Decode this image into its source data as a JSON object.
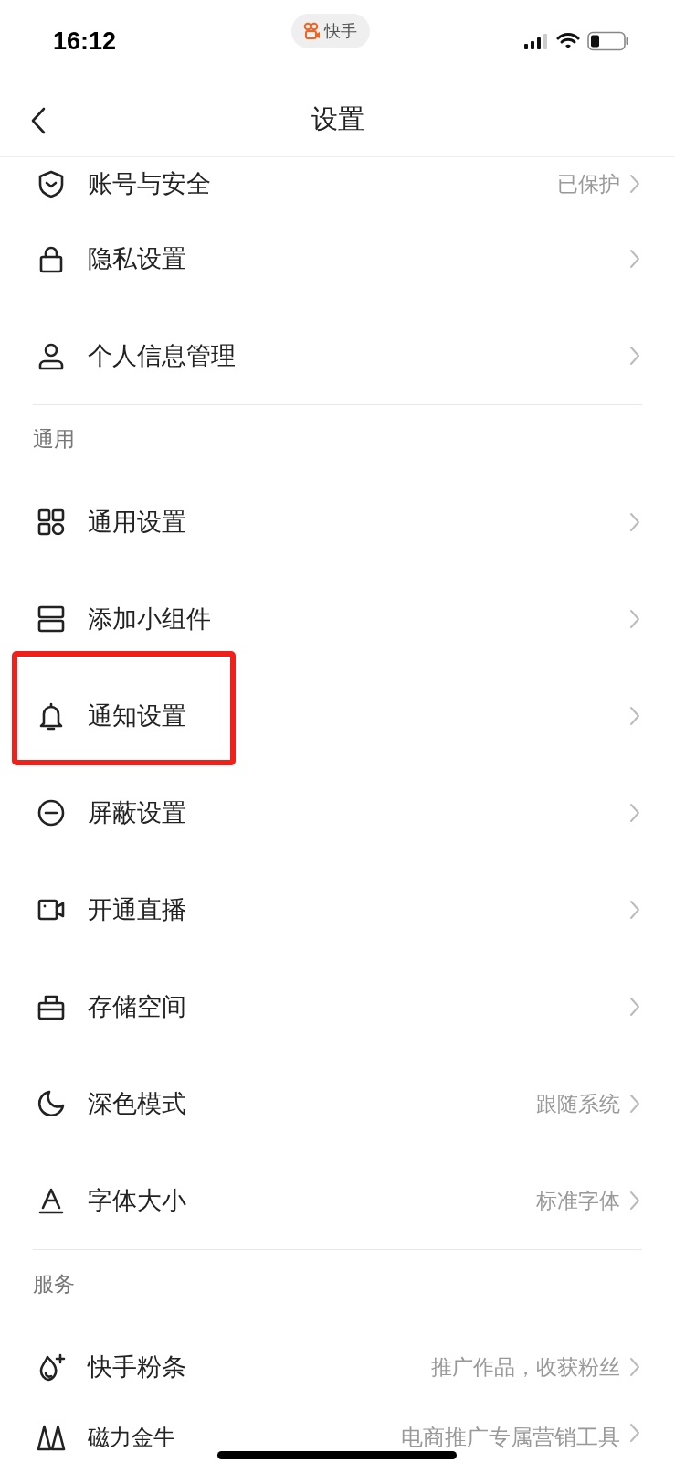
{
  "status_bar": {
    "time": "16:12",
    "app_pill": "快手"
  },
  "nav": {
    "title": "设置"
  },
  "sections": [
    {
      "items": [
        {
          "label": "账号与安全",
          "value": "已保护",
          "highlighted": false
        },
        {
          "label": "隐私设置",
          "highlighted": false
        },
        {
          "label": "个人信息管理",
          "highlighted": false
        }
      ]
    },
    {
      "header": "通用",
      "items": [
        {
          "label": "通用设置",
          "highlighted": false
        },
        {
          "label": "添加小组件",
          "highlighted": false
        },
        {
          "label": "通知设置",
          "highlighted": true
        },
        {
          "label": "屏蔽设置",
          "highlighted": false
        },
        {
          "label": "开通直播",
          "highlighted": false
        },
        {
          "label": "存储空间",
          "highlighted": false
        },
        {
          "label": "深色模式",
          "value": "跟随系统",
          "highlighted": false
        },
        {
          "label": "字体大小",
          "value": "标准字体",
          "highlighted": false
        }
      ]
    },
    {
      "header": "服务",
      "items": [
        {
          "label": "快手粉条",
          "value": "推广作品，收获粉丝",
          "highlighted": false
        },
        {
          "label": "磁力金牛",
          "value": "电商推广专属营销工具",
          "highlighted": false
        }
      ]
    }
  ]
}
